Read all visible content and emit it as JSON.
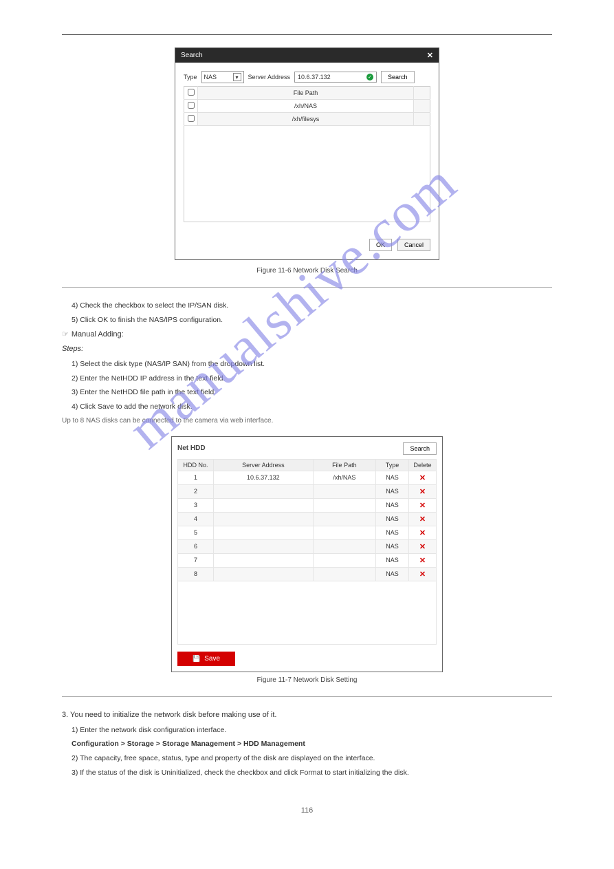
{
  "watermark": "manualshive.com",
  "dialog1": {
    "title": "Search",
    "type_label": "Type",
    "type_value": "NAS",
    "addr_label": "Server Address",
    "addr_value": "10.6.37.132",
    "search_btn": "Search",
    "col_path": "File Path",
    "rows": [
      "/xh/NAS",
      "/xh/filesys"
    ],
    "ok": "OK",
    "cancel": "Cancel"
  },
  "captions": {
    "fig1": "Figure 11-6 Network Disk Search",
    "fig2": "Figure 11-7 Network Disk Setting"
  },
  "body": {
    "l1": "4) Check the checkbox to select the IP/SAN disk.",
    "l2": "5) Click OK to finish the NAS/IPS configuration.",
    "l3": "Manual Adding:",
    "l4": "Steps:",
    "l5": "1) Select the disk type (NAS/IP SAN) from the dropdown list.",
    "l6": "2) Enter the NetHDD IP address in the text field.",
    "l7": "3) Enter the NetHDD file path in the text field.",
    "l8": "4) Click Save to add the network disk.",
    "note": "Up to 8 NAS disks can be connected to the camera via web interface."
  },
  "panel2": {
    "title": "Net HDD",
    "search_btn": "Search",
    "cols": {
      "hdd": "HDD No.",
      "addr": "Server Address",
      "path": "File Path",
      "type": "Type",
      "del": "Delete"
    },
    "rows": [
      {
        "no": "1",
        "addr": "10.6.37.132",
        "path": "/xh/NAS",
        "type": "NAS"
      },
      {
        "no": "2",
        "addr": "",
        "path": "",
        "type": "NAS"
      },
      {
        "no": "3",
        "addr": "",
        "path": "",
        "type": "NAS"
      },
      {
        "no": "4",
        "addr": "",
        "path": "",
        "type": "NAS"
      },
      {
        "no": "5",
        "addr": "",
        "path": "",
        "type": "NAS"
      },
      {
        "no": "6",
        "addr": "",
        "path": "",
        "type": "NAS"
      },
      {
        "no": "7",
        "addr": "",
        "path": "",
        "type": "NAS"
      },
      {
        "no": "8",
        "addr": "",
        "path": "",
        "type": "NAS"
      }
    ],
    "save": "Save"
  },
  "tail": {
    "step3": "3. You need to initialize the network disk before making use of it.",
    "init1": "1) Enter the network disk configuration interface.",
    "init_path": "Configuration > Storage > Storage Management > HDD Management",
    "init2": "2) The capacity, free space, status, type and property of the disk are displayed on the interface.",
    "init3": "3) If the status of the disk is Uninitialized, check the checkbox and click Format to start initializing the disk."
  },
  "page_num": "116"
}
